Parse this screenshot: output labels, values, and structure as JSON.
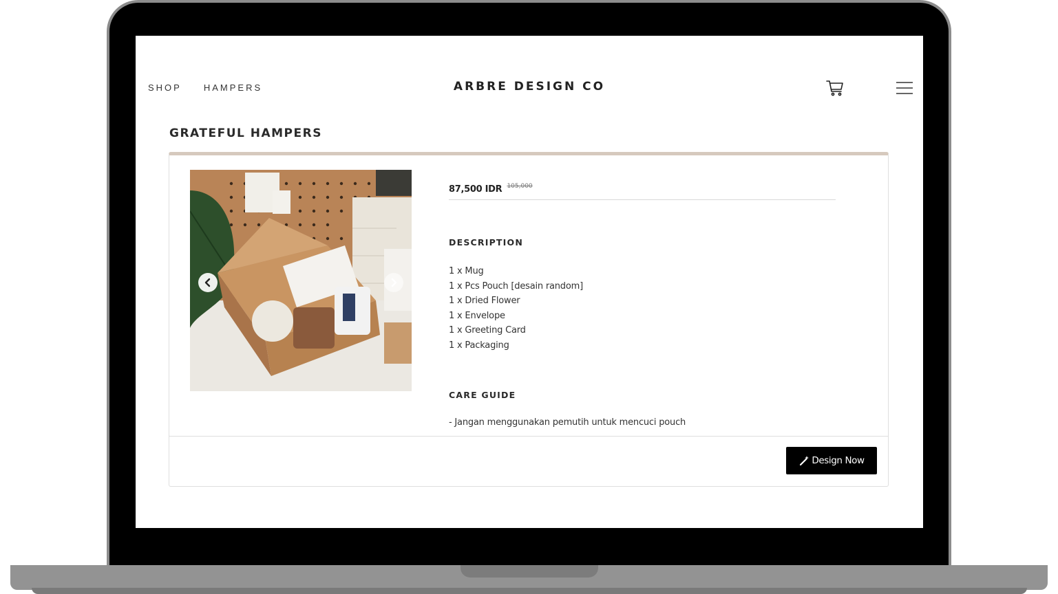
{
  "nav": {
    "links": [
      {
        "label": "SHOP"
      },
      {
        "label": "HAMPERS"
      }
    ],
    "brand": "ARBRE DESIGN CO",
    "cart_icon": "cart-icon",
    "menu_icon": "hamburger-menu-icon"
  },
  "product": {
    "title": "GRATEFUL HAMPERS",
    "price": "87,500 IDR",
    "original_price": "105,000",
    "description_heading": "DESCRIPTION",
    "items": [
      "1 x Mug",
      "1 x Pcs Pouch [desain random]",
      "1 x Dried Flower",
      "1 x Envelope",
      "1 x Greeting Card",
      "1 x Packaging"
    ],
    "care_heading": "CARE GUIDE",
    "care_text": "- Jangan menggunakan pemutih untuk mencuci pouch",
    "cta_label": "Design Now",
    "cta_icon": "magic-wand-icon"
  },
  "colors": {
    "accent_bar": "#d6c9bd",
    "cta_background": "#000000"
  }
}
